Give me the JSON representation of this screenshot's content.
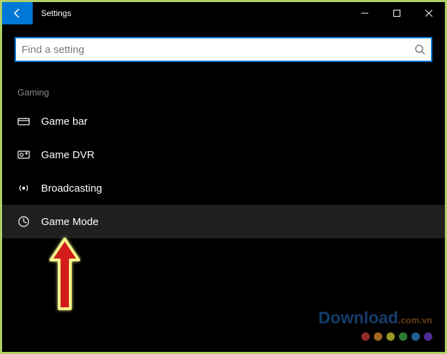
{
  "window": {
    "title": "Settings"
  },
  "search": {
    "placeholder": "Find a setting",
    "value": ""
  },
  "section": {
    "header": "Gaming",
    "items": [
      {
        "label": "Game bar",
        "icon": "gamebar-icon",
        "selected": false
      },
      {
        "label": "Game DVR",
        "icon": "gamedvr-icon",
        "selected": false
      },
      {
        "label": "Broadcasting",
        "icon": "broadcast-icon",
        "selected": false
      },
      {
        "label": "Game Mode",
        "icon": "gamemode-icon",
        "selected": true
      }
    ]
  },
  "watermark": {
    "brand_main": "Download",
    "brand_ext": ".com.vn",
    "dot_colors": [
      "#c43a3a",
      "#d88b2a",
      "#c9c92f",
      "#3aa64a",
      "#2f7fc9",
      "#6a3ac9"
    ]
  }
}
